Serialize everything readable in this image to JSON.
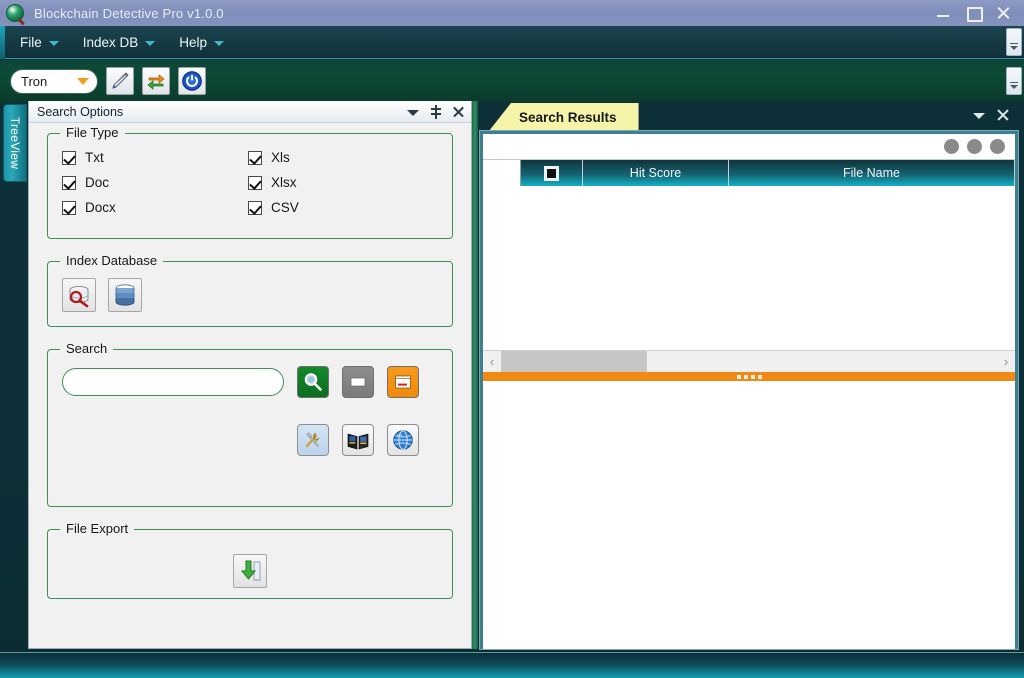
{
  "window": {
    "title": "Blockchain Detective Pro v1.0.0",
    "app_icon": "magnifier-app-icon",
    "minimize_label": "Minimize",
    "maximize_label": "Maximize",
    "close_label": "Close"
  },
  "menubar": {
    "items": [
      {
        "label": "File",
        "icon": "chevron-down-icon"
      },
      {
        "label": "Index DB",
        "icon": "chevron-down-icon"
      },
      {
        "label": "Help",
        "icon": "chevron-down-icon"
      }
    ],
    "overflow_icon": "menu-overflow-icon"
  },
  "toolbar": {
    "chain_select": {
      "value": "Tron",
      "options": [
        "Tron"
      ],
      "arrow_icon": "chevron-down-icon",
      "arrow_color": "#f59b1e"
    },
    "buttons": [
      {
        "name": "edit-button",
        "icon": "pencil-icon"
      },
      {
        "name": "refresh-button",
        "icon": "refresh-arrows-icon"
      },
      {
        "name": "power-button",
        "icon": "power-icon"
      }
    ],
    "overflow_icon": "toolbar-overflow-icon"
  },
  "treeview_tab": {
    "label": "TreeView"
  },
  "search_options_panel": {
    "title": "Search Options",
    "caption_buttons": [
      {
        "name": "panel-dropdown-button",
        "icon": "chevron-down-icon"
      },
      {
        "name": "panel-pin-button",
        "icon": "pin-icon"
      },
      {
        "name": "panel-close-button",
        "icon": "close-icon"
      }
    ],
    "file_type": {
      "legend": "File Type",
      "items": [
        {
          "label": "Txt",
          "checked": true
        },
        {
          "label": "Xls",
          "checked": true
        },
        {
          "label": "Doc",
          "checked": true
        },
        {
          "label": "Xlsx",
          "checked": true
        },
        {
          "label": "Docx",
          "checked": true
        },
        {
          "label": "CSV",
          "checked": true
        }
      ]
    },
    "index_database": {
      "legend": "Index Database",
      "buttons": [
        {
          "name": "search-index-db-button",
          "icon": "db-search-icon"
        },
        {
          "name": "build-index-db-button",
          "icon": "database-stack-icon"
        }
      ]
    },
    "search": {
      "legend": "Search",
      "input_value": "",
      "input_placeholder": "",
      "buttons_row1": [
        {
          "name": "run-search-button",
          "icon": "magnifier-icon",
          "color": "#12892a"
        },
        {
          "name": "clear-results-button",
          "icon": "blank-window-icon",
          "color": "#8d8d8d"
        },
        {
          "name": "open-viewer-button",
          "icon": "window-edit-icon",
          "color": "#f8991d"
        }
      ],
      "buttons_row2": [
        {
          "name": "tools-button",
          "icon": "tools-icon"
        },
        {
          "name": "dictionary-button",
          "icon": "open-book-icon"
        },
        {
          "name": "web-search-button",
          "icon": "globe-icon"
        }
      ]
    },
    "file_export": {
      "legend": "File Export",
      "buttons": [
        {
          "name": "export-download-button",
          "icon": "download-arrow-icon"
        }
      ]
    }
  },
  "results_panel": {
    "tab_label": "Search Results",
    "tab_color": "#f6f4a8",
    "caption_buttons": [
      {
        "name": "results-dropdown-button",
        "icon": "chevron-down-icon"
      },
      {
        "name": "results-close-button",
        "icon": "close-icon"
      }
    ],
    "grid_toolbar_dots": [
      {
        "name": "grid-option-dot-1",
        "icon": "circle-icon"
      },
      {
        "name": "grid-option-dot-2",
        "icon": "circle-icon"
      },
      {
        "name": "grid-option-dot-3",
        "icon": "circle-icon"
      }
    ],
    "columns": [
      {
        "label": "",
        "name": "row-corner-column"
      },
      {
        "label": "",
        "name": "select-all-column",
        "icon": "checkbox-icon"
      },
      {
        "label": "Hit Score",
        "name": "hit-score-column"
      },
      {
        "label": "File Name",
        "name": "file-name-column"
      }
    ],
    "rows": [],
    "hscroll": {
      "left_arrow": "‹",
      "right_arrow": "›"
    },
    "splitter_color": "#f08a14"
  },
  "colors": {
    "accent_teal": "#14a0b4",
    "panel_green": "#3f8f55",
    "splitter_orange": "#f08a14",
    "tab_yellow": "#f6f4a8",
    "title_blue": "#8492bd"
  }
}
